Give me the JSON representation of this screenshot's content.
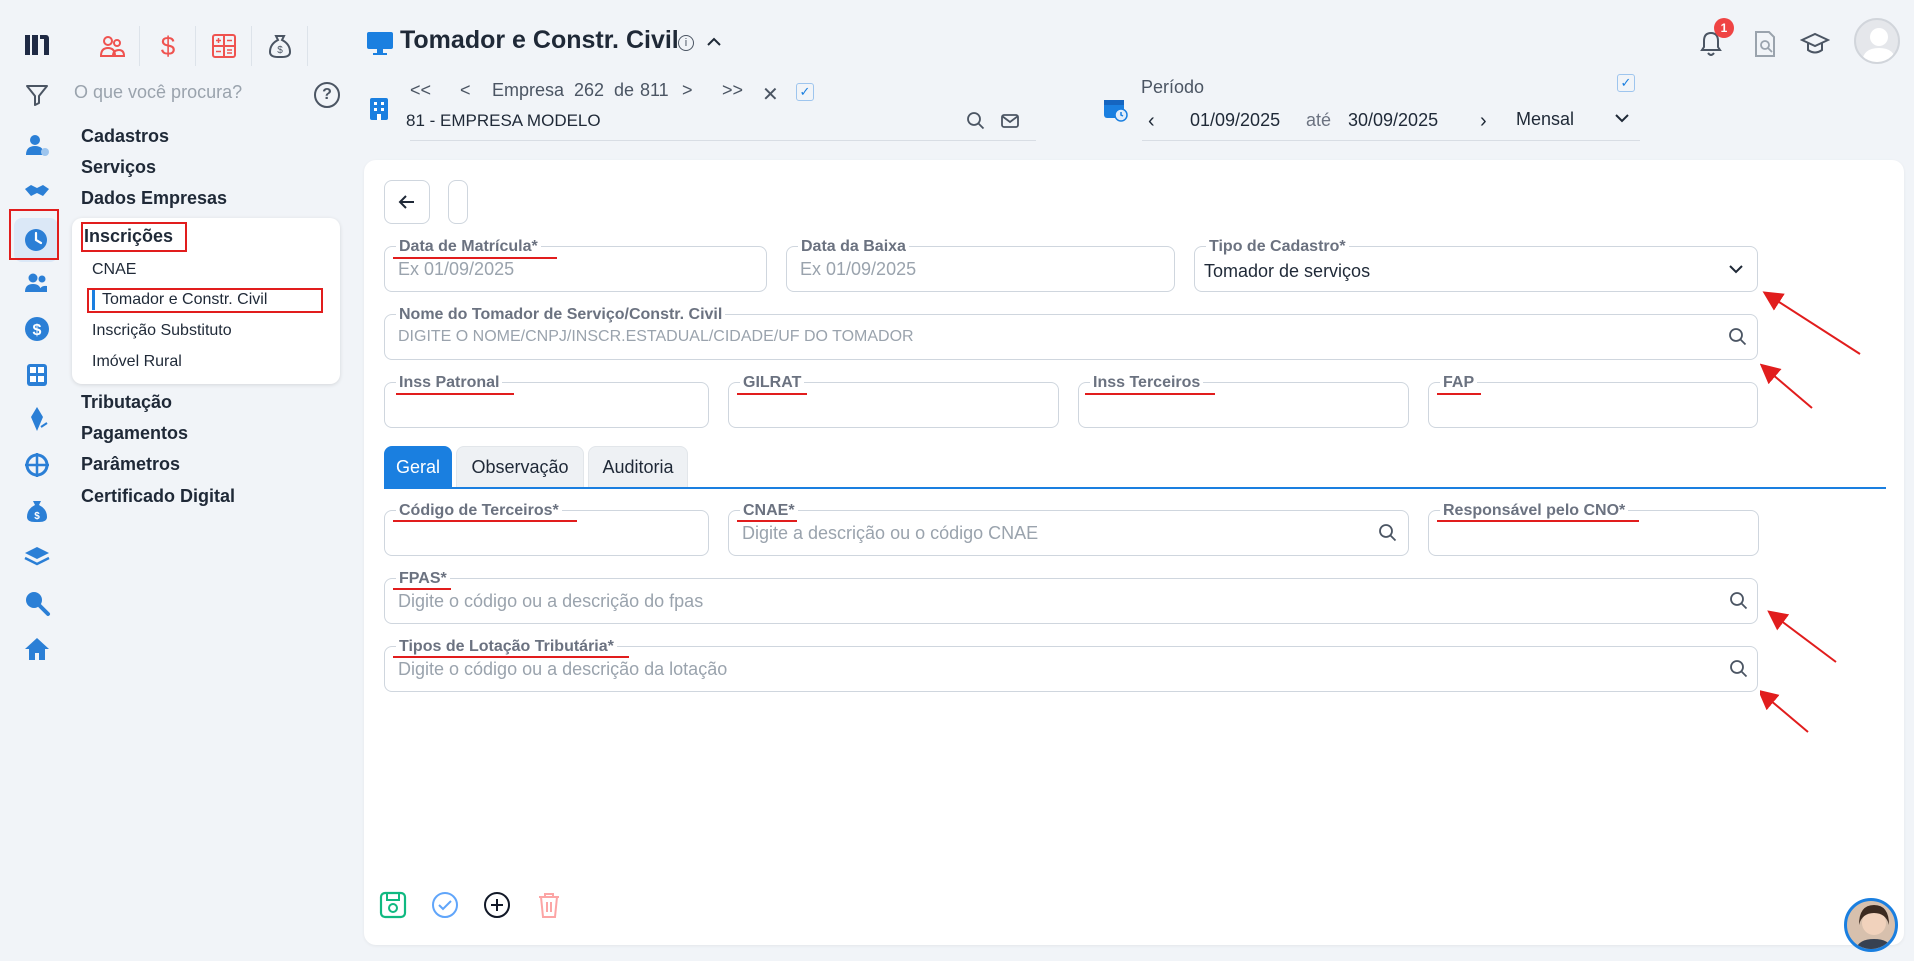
{
  "search": {
    "placeholder": "O que você procura?"
  },
  "menu": {
    "items": [
      "Cadastros",
      "Serviços",
      "Dados Empresas",
      "Inscrições"
    ],
    "sub_items": [
      "CNAE",
      "Tomador e Constr. Civil",
      "Inscrição Substituto",
      "Imóvel Rural"
    ],
    "items_after": [
      "Tributação",
      "Pagamentos",
      "Parâmetros",
      "Certificado Digital"
    ]
  },
  "header": {
    "title": "Tomador e Constr. Civil",
    "nav_first": "<<",
    "nav_prev": "<",
    "empresa_label": "Empresa",
    "empresa_current": "262",
    "empresa_de": "de",
    "empresa_total": "811",
    "nav_next": ">",
    "nav_last": ">>",
    "company_name": "81 - EMPRESA MODELO",
    "periodo_label": "Período",
    "periodo_start": "01/09/2025",
    "periodo_ate": "até",
    "periodo_end": "30/09/2025",
    "periodo_type": "Mensal",
    "notification_count": "1"
  },
  "form": {
    "data_matricula_label": "Data de Matrícula*",
    "data_matricula_placeholder": "Ex 01/09/2025",
    "data_baixa_label": "Data da Baixa",
    "data_baixa_placeholder": "Ex 01/09/2025",
    "tipo_cadastro_label": "Tipo de Cadastro*",
    "tipo_cadastro_value": "Tomador de serviços",
    "nome_tomador_label": "Nome do Tomador de Serviço/Constr. Civil",
    "nome_tomador_placeholder": "DIGITE O NOME/CNPJ/INSCR.ESTADUAL/CIDADE/UF DO TOMADOR",
    "inss_patronal_label": "Inss Patronal",
    "gilrat_label": "GILRAT",
    "inss_terceiros_label": "Inss Terceiros",
    "fap_label": "FAP",
    "tabs": [
      "Geral",
      "Observação",
      "Auditoria"
    ],
    "codigo_terceiros_label": "Código de Terceiros*",
    "cnae_label": "CNAE*",
    "cnae_placeholder": "Digite a descrição ou o código CNAE",
    "responsavel_cno_label": "Responsável pelo CNO*",
    "fpas_label": "FPAS*",
    "fpas_placeholder": "Digite o código ou a descrição do fpas",
    "lotacao_label": "Tipos de Lotação Tributária*",
    "lotacao_placeholder": "Digite o código ou a descrição da lotação"
  },
  "colors": {
    "accent": "#1a7fe0",
    "annotation": "#e11d1d",
    "green": "#10b981",
    "danger": "#f87171"
  }
}
